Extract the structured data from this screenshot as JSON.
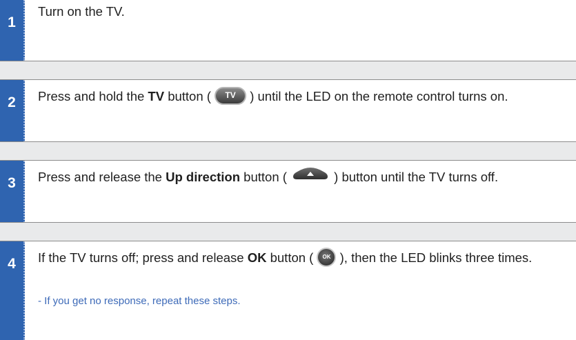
{
  "steps": [
    {
      "number": "1",
      "text": "Turn on the TV."
    },
    {
      "number": "2",
      "text_before": "Press and hold the ",
      "bold": "TV",
      "text_mid": " button ( ",
      "button_label": "TV",
      "text_after": " ) until the LED on the remote control turns on."
    },
    {
      "number": "3",
      "text_before": "Press and release the ",
      "bold": "Up direction",
      "text_mid": " button ( ",
      "text_after": " ) button until the TV turns off."
    },
    {
      "number": "4",
      "text_before": "If the TV turns off; press and release ",
      "bold": "OK",
      "text_mid": " button ( ",
      "button_label": "OK",
      "text_after": " ), then the LED blinks three times.",
      "note": "- If you get no response, repeat these steps."
    }
  ],
  "icons": {
    "tv_button": "tv-button-icon",
    "up_direction": "up-direction-button-icon",
    "ok_button": "ok-button-icon"
  },
  "colors": {
    "step_number_bg": "#2f64b0",
    "note_text": "#3d6ab8",
    "band_bg": "#e9eaeb"
  }
}
